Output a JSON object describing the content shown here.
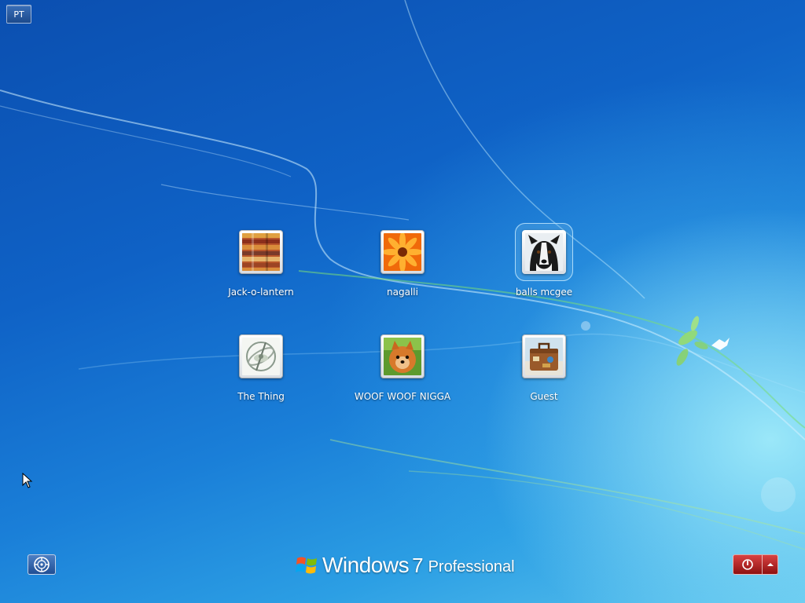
{
  "language": {
    "label": "PT"
  },
  "users": [
    {
      "name": "Jack-o-lantern",
      "picture": "striped-fabric-picture"
    },
    {
      "name": "nagalli",
      "picture": "orange-flower-picture"
    },
    {
      "name": "balls mcgee",
      "picture": "border-collie-picture",
      "selected": true
    },
    {
      "name": "The Thing",
      "picture": "gyroscope-picture"
    },
    {
      "name": "WOOF WOOF NIGGA",
      "picture": "pomeranian-picture"
    },
    {
      "name": "Guest",
      "picture": "suitcase-picture"
    }
  ],
  "branding": {
    "name": "Windows",
    "version": "7",
    "edition": "Professional"
  },
  "bottom_bar": {
    "ease_of_access_icon": "ease-of-access-icon",
    "power_icon": "power-icon",
    "power_menu_icon": "chevron-up-icon"
  },
  "colors": {
    "background_top": "#0b4fb0",
    "background_bottom": "#5cc4ee",
    "power_button": "#b52020"
  }
}
